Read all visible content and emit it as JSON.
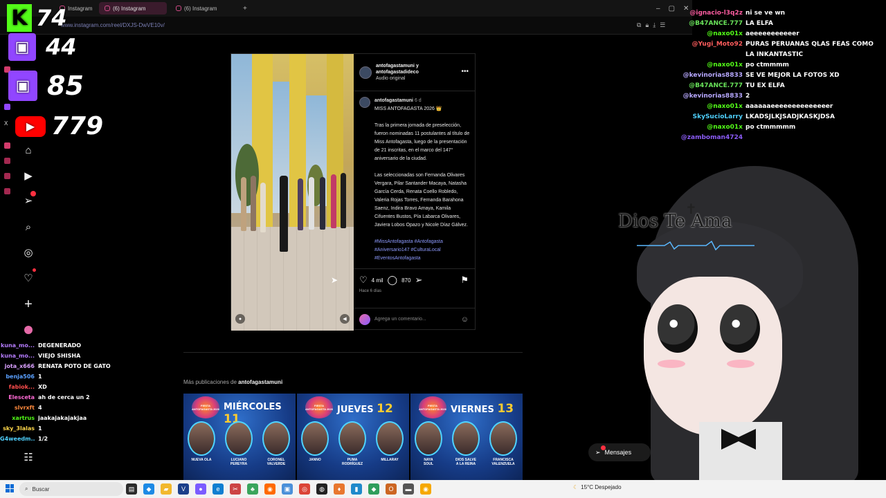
{
  "browser": {
    "tabs": [
      {
        "label": "Instagram"
      },
      {
        "label": "(6) Instagram"
      },
      {
        "label": "(6) Instagram"
      }
    ],
    "url": "www.instagram.com/reel/DXJS-DwVE10v/"
  },
  "overlay": {
    "kick_count": "74",
    "kick_letter": "K",
    "twitch_a_count": "44",
    "twitch_b_count": "85",
    "youtube_count": "779"
  },
  "post": {
    "author_line1": "antofagastamuni y",
    "author_line2": "antofagastadideco",
    "audio": "Audio original",
    "caption_user": "antofagastamuni",
    "caption_time": "6 d",
    "caption_title": "MISS ANTOFAGASTA 2026 👑",
    "paragraph1": "Tras la primera jornada de preselección, fueron nominadas 11 postulantes al título de Miss Antofagasta, luego de la presentación de 21 inscritas, en el marco del 147° aniversario de la ciudad.",
    "paragraph2": "Las seleccionadas son Fernanda Olivares Vergara, Pilar Santander Macaya, Natasha García Cerda, Renata Coello Robledo, Valeria Rojas Torres, Fernanda Barahona Saenz, Indira Bravo Amaya, Kamila Cifuentes Bustos, Pía Labarca Olivares, Javiera Lobos Opazo y Nicole Díaz Gálvez.",
    "tags": "#MissAntofagasta #Antofagasta #Aniversario147 #CulturaLocal #EventosAntofagasta",
    "likes": "4 mil",
    "comments": "870",
    "ago": "Hace 6 días",
    "comment_placeholder": "Agrega un comentario..."
  },
  "more_from": {
    "prefix": "Más publicaciones de ",
    "user": "antofagastamuni"
  },
  "promos": [
    {
      "badge": "FIESTA ANTOFAGASTA 2026",
      "day": "MIÉRCOLES",
      "num": "11",
      "artists": [
        "NUEVA OLA",
        "LUCIANO\nPEREYRA",
        "CORONEL\nVALVERDE"
      ]
    },
    {
      "badge": "FIESTA ANTOFAGASTA 2026",
      "day": "JUEVES",
      "num": "12",
      "artists": [
        "JANNO",
        "PUMA\nRODRÍGUEZ",
        "MILLARAY"
      ]
    },
    {
      "badge": "FIESTA ANTOFAGASTA 2026",
      "day": "VIERNES",
      "num": "13",
      "artists": [
        "NAYA\nSOUL",
        "DIOS SALVE\nA LA REINA",
        "FRANCISCA\nVALENZUELA"
      ]
    }
  ],
  "chat_right": [
    {
      "user": "@ignacio-l3q2z",
      "msg": "ni se ve wn",
      "color": "#ff5da2"
    },
    {
      "user": "@B47ANCE.777",
      "msg": "LA ELFA",
      "color": "#69e35a"
    },
    {
      "user": "@naxo01x",
      "msg": "aeeeeeeeeeeer",
      "color": "#53fc18"
    },
    {
      "user": "@Yugi_Moto92",
      "msg": "PURAS PERUANAS QLAS FEAS COMO LA INKANTASTIC",
      "color": "#ff5d5d"
    },
    {
      "user": "@naxo01x",
      "msg": "po ctmmmm",
      "color": "#53fc18"
    },
    {
      "user": "@kevinorias8833",
      "msg": "SE VE MEJOR LA FOTOS XD",
      "color": "#b7a8ff"
    },
    {
      "user": "@B47ANCE.777",
      "msg": "TU EX ELFA",
      "color": "#69e35a"
    },
    {
      "user": "@kevinorias8833",
      "msg": "2",
      "color": "#b7a8ff"
    },
    {
      "user": "@naxo01x",
      "msg": "aaaaaaeeeeeeeeeeeeeer",
      "color": "#53fc18"
    },
    {
      "user": "SkySucioLarry",
      "msg": "LKADSJLKJSADJKASKJDSA",
      "color": "#4fd1ff"
    },
    {
      "user": "@naxo01x",
      "msg": "po ctmmmmm",
      "color": "#53fc18"
    },
    {
      "user": "@zamboman4724",
      "msg": "",
      "color": "#8b5cf6"
    }
  ],
  "chat_left": [
    {
      "user": "kuna_mo...",
      "msg": "DEGENERADO",
      "color": "#b57cff"
    },
    {
      "user": "kuna_mo...",
      "msg": "VIEJO SHISHA",
      "color": "#b57cff"
    },
    {
      "user": "jota_x666",
      "msg": "RENATA POTO DE GATO",
      "color": "#d9a0ff"
    },
    {
      "user": "benja506",
      "msg": "1",
      "color": "#5aa0ff"
    },
    {
      "user": "fabiok...",
      "msg": "XD",
      "color": "#ff4d4d"
    },
    {
      "user": "Elesceta",
      "msg": "ah de cerca un 2",
      "color": "#ff6ad5"
    },
    {
      "user": "slvrxft",
      "msg": "4",
      "color": "#ff8a3d"
    },
    {
      "user": "xartrus",
      "msg": "jaakajakajakjaa",
      "color": "#53fc18"
    },
    {
      "user": "sky_3lalas",
      "msg": "1",
      "color": "#ffd84a"
    },
    {
      "user": "G4weedm...",
      "msg": "1/2",
      "color": "#4fd1ff"
    }
  ],
  "avatar": {
    "text": "Dios Te Ama"
  },
  "messages_pill": "Mensajes",
  "taskbar": {
    "search": "Buscar",
    "weather": "15°C  Despejado"
  },
  "colors": {
    "instagram_link": "#8e9bff",
    "kick": "#53fc18",
    "twitch": "#9146ff",
    "youtube": "#ff0000"
  }
}
